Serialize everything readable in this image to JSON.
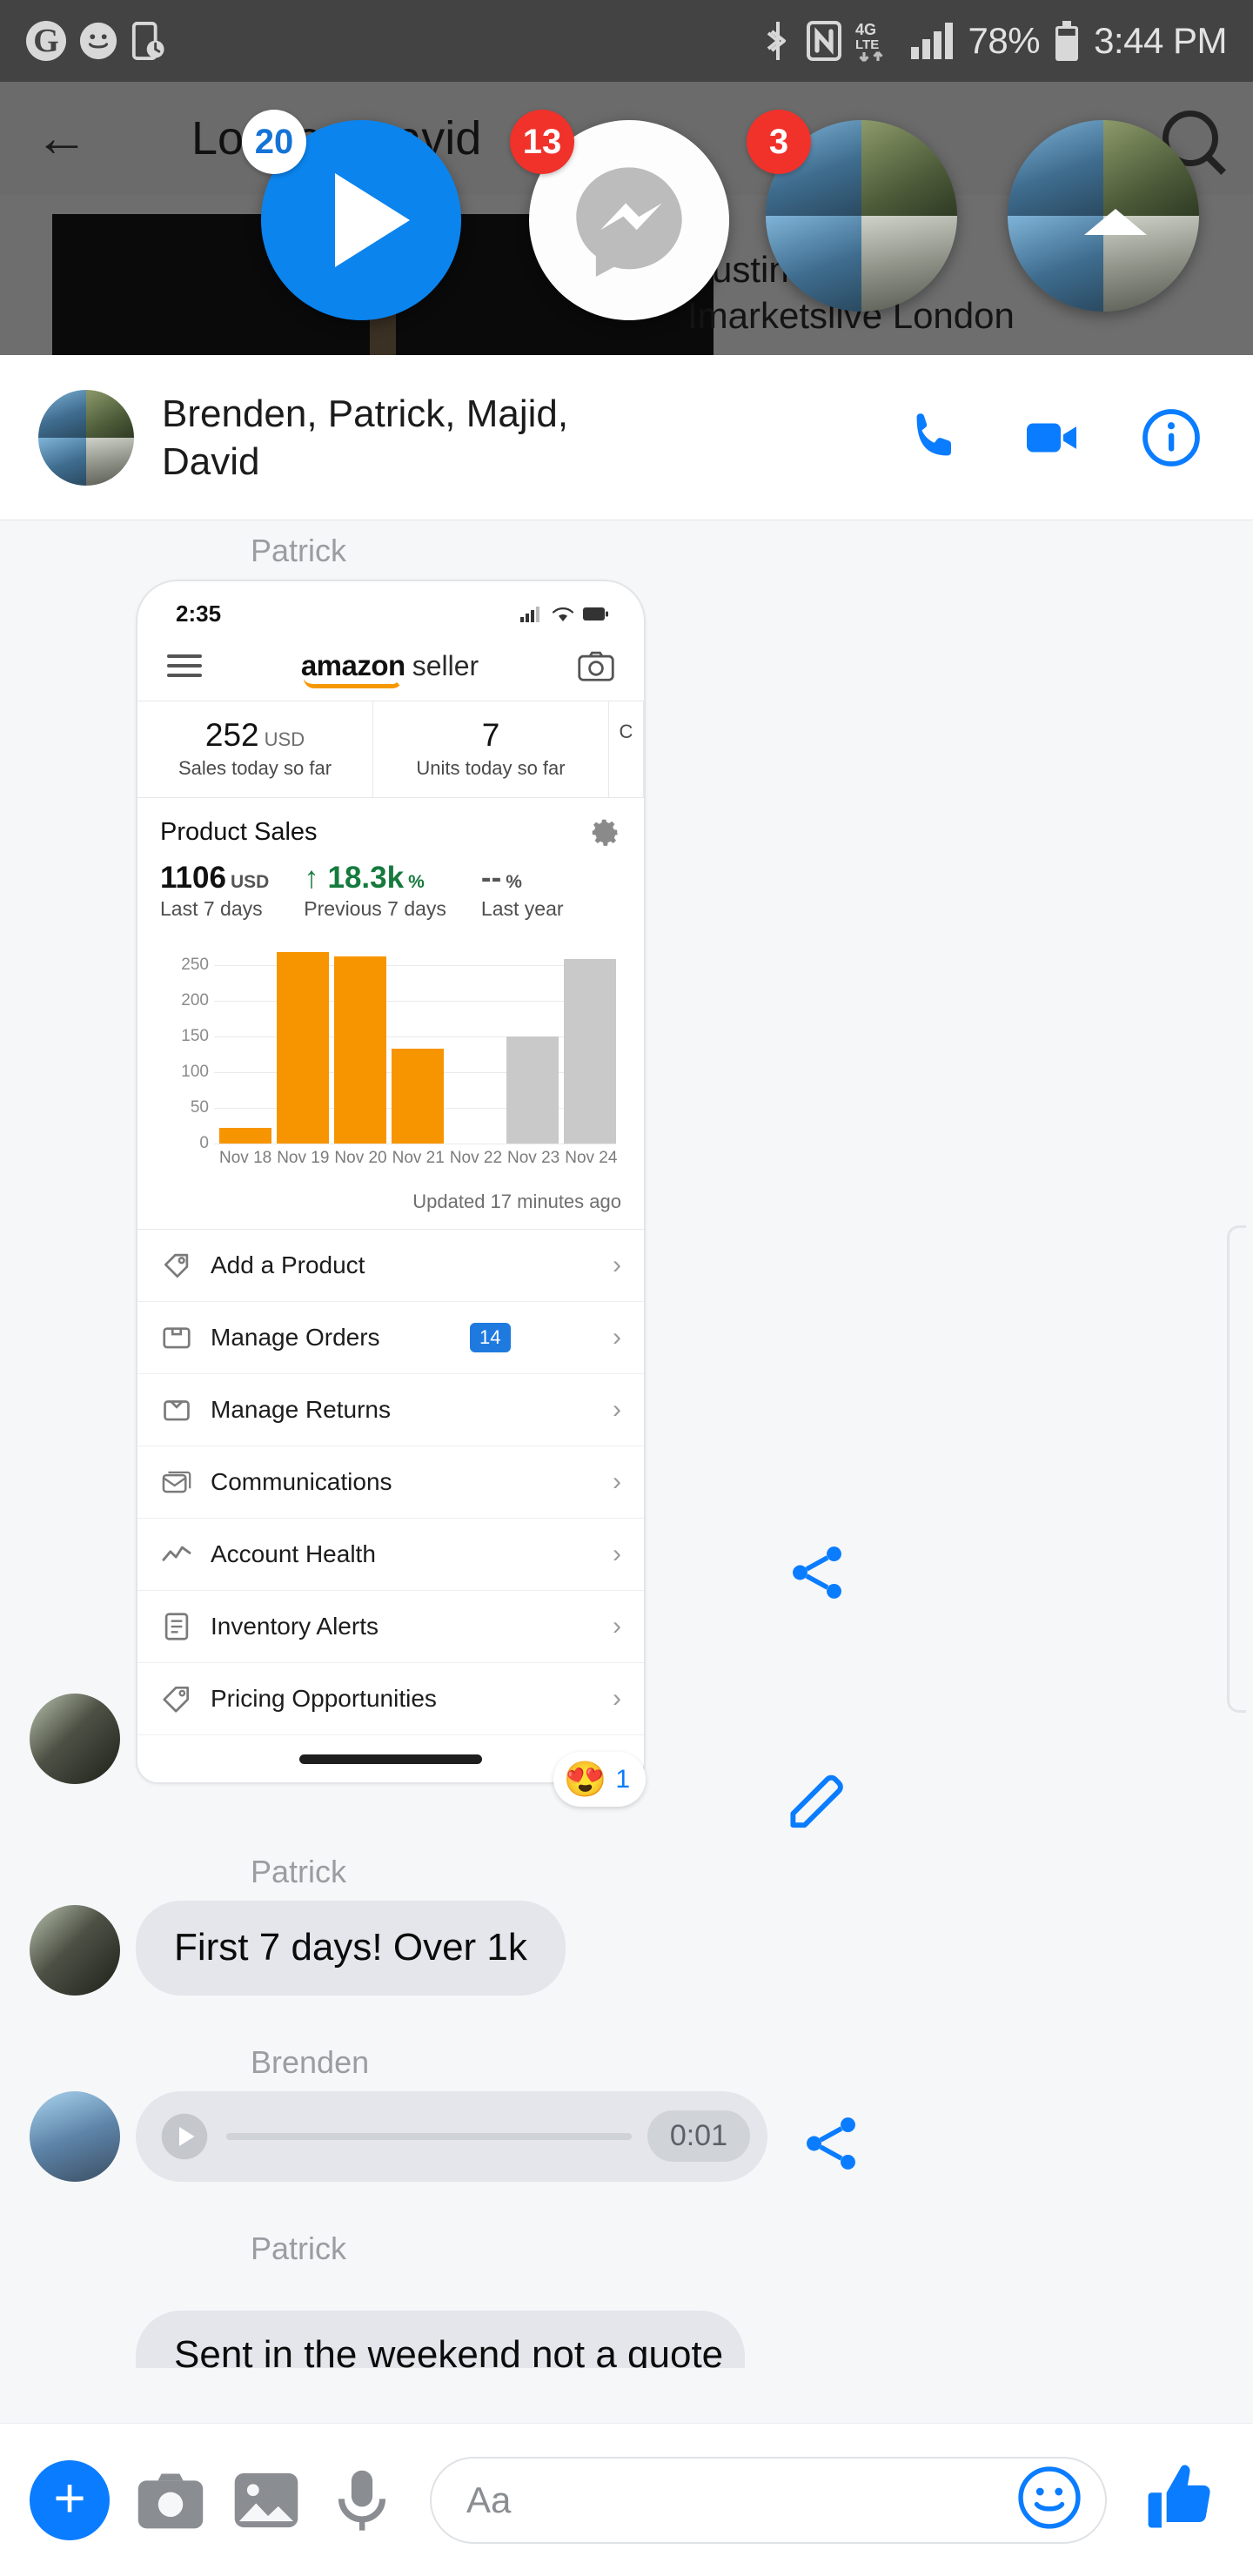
{
  "status_bar": {
    "left_icons": [
      "google-icon",
      "smiley-icon",
      "digital-wellbeing-icon"
    ],
    "right_icons": [
      "bluetooth-icon",
      "nfc-icon",
      "4g-lte-icon",
      "signal-icon",
      "battery-icon"
    ],
    "battery_percent": "78%",
    "time": "3:44 PM"
  },
  "background_app": {
    "back_label": "back-arrow",
    "title": "London David",
    "search_label": "search-icon",
    "post_author": "Austin Ge...ry",
    "post_group": "Imarketslive London",
    "menu_label": "more-options"
  },
  "chat_heads": [
    {
      "name": "video-player-head",
      "badge": "20",
      "badge_style": "white",
      "icon": "play-icon"
    },
    {
      "name": "messenger-head",
      "badge": "13",
      "badge_style": "red",
      "icon": "messenger-bolt-icon"
    },
    {
      "name": "group-head-1",
      "badge": "3",
      "badge_style": "red",
      "icon": "avatar-collage"
    },
    {
      "name": "group-head-2",
      "badge": "",
      "badge_style": "none",
      "icon": "avatar-collage"
    }
  ],
  "conversation": {
    "title": "Brenden, Patrick, Majid, David",
    "avatar": "group-avatar-collage",
    "actions": [
      {
        "name": "voice-call-button",
        "icon": "phone-icon"
      },
      {
        "name": "video-call-button",
        "icon": "video-camera-icon"
      },
      {
        "name": "conversation-info-button",
        "icon": "info-icon"
      }
    ]
  },
  "messages": [
    {
      "sender": "Patrick",
      "type": "attachment",
      "reaction_emoji": "😍",
      "reaction_count": "1"
    },
    {
      "sender": "Patrick",
      "type": "text",
      "text": "First 7 days! Over 1k"
    },
    {
      "sender": "Brenden",
      "type": "voice",
      "duration": "0:01"
    },
    {
      "sender": "Patrick",
      "type": "text-partial",
      "text": "Sent in the weekend not a quote"
    }
  ],
  "side_actions": [
    {
      "name": "share-attachment-button",
      "icon": "share-icon"
    },
    {
      "name": "edit-attachment-button",
      "icon": "pencil-icon"
    },
    {
      "name": "share-voice-button",
      "icon": "share-icon"
    }
  ],
  "attachment_card": {
    "app_name": "amazon seller",
    "amazon_word": "amazon",
    "seller_word": "seller",
    "status_time": "2:35",
    "nav": {
      "menu_icon": "hamburger-icon",
      "camera_icon": "camera-icon"
    },
    "stats": [
      {
        "value": "252",
        "unit": "USD",
        "label": "Sales today so far"
      },
      {
        "value": "7",
        "unit": "",
        "label": "Units today so far"
      },
      {
        "value": "",
        "unit": "",
        "label": "C"
      }
    ],
    "product_sales": {
      "title": "Product Sales",
      "gear_icon": "gear-icon",
      "metrics": [
        {
          "value": "1106",
          "unit": "USD",
          "label": "Last 7 days",
          "style": "normal"
        },
        {
          "value": "↑ 18.3k",
          "unit": "%",
          "label": "Previous 7 days",
          "style": "green"
        },
        {
          "value": "--",
          "unit": "%",
          "label": "Last year",
          "style": "grey"
        }
      ],
      "updated": "Updated 17 minutes ago"
    },
    "menu_items": [
      {
        "label": "Add a Product",
        "icon": "tag-icon",
        "badge": ""
      },
      {
        "label": "Manage Orders",
        "icon": "box-icon",
        "badge": "14"
      },
      {
        "label": "Manage Returns",
        "icon": "return-box-icon",
        "badge": ""
      },
      {
        "label": "Communications",
        "icon": "envelope-icon",
        "badge": ""
      },
      {
        "label": "Account Health",
        "icon": "chart-line-icon",
        "badge": ""
      },
      {
        "label": "Inventory Alerts",
        "icon": "list-icon",
        "badge": ""
      },
      {
        "label": "Pricing Opportunities",
        "icon": "price-tag-icon",
        "badge": ""
      }
    ]
  },
  "chart_data": {
    "type": "bar",
    "title": "Product Sales",
    "categories": [
      "Nov 18",
      "Nov 19",
      "Nov 20",
      "Nov 21",
      "Nov 22",
      "Nov 23",
      "Nov 24"
    ],
    "values": [
      22,
      268,
      262,
      133,
      0,
      150,
      258
    ],
    "colors": [
      "#f79500",
      "#f79500",
      "#f79500",
      "#f79500",
      "#f79500",
      "#c9c9c9",
      "#c9c9c9"
    ],
    "yticks": [
      250,
      200,
      150,
      100,
      50,
      0
    ],
    "ylim": [
      0,
      280
    ],
    "xlabel": "",
    "ylabel": "",
    "grid": true,
    "legend": "none"
  },
  "composer": {
    "plus_label": "+",
    "placeholder": "Aa",
    "icons": [
      {
        "name": "add-button",
        "icon": "plus-icon"
      },
      {
        "name": "camera-button",
        "icon": "camera-icon"
      },
      {
        "name": "gallery-button",
        "icon": "image-icon"
      },
      {
        "name": "voice-record-button",
        "icon": "microphone-icon"
      },
      {
        "name": "emoji-button",
        "icon": "smiley-icon"
      },
      {
        "name": "like-button",
        "icon": "thumbs-up-icon"
      }
    ]
  },
  "colors": {
    "accent": "#0a7cff",
    "badge_red": "#f0322b",
    "amazon_orange": "#f79500",
    "bubble_grey": "#e4e6eb"
  }
}
